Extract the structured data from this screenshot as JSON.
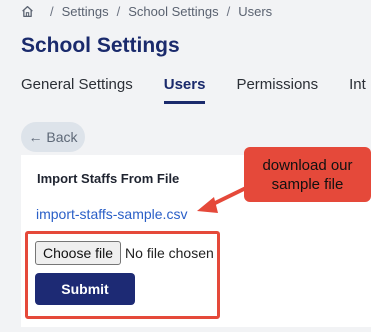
{
  "breadcrumb": {
    "home_icon": "home-icon",
    "items": [
      "Settings",
      "School Settings",
      "Users"
    ],
    "separator": "/"
  },
  "page": {
    "title": "School Settings"
  },
  "tabs": [
    {
      "label": "General Settings",
      "active": false
    },
    {
      "label": "Users",
      "active": true
    },
    {
      "label": "Permissions",
      "active": false
    },
    {
      "label": "Int",
      "active": false
    }
  ],
  "back_button": {
    "label": "← Back"
  },
  "import_card": {
    "heading": "Import Staffs From File",
    "sample_link": "import-staffs-sample.csv",
    "choose_file_label": "Choose file",
    "file_status": "No file chosen",
    "submit_label": "Submit"
  },
  "annotation": {
    "callout_text": "download our sample file",
    "color": "#e5493a"
  },
  "colors": {
    "brand": "#1a2a6c",
    "submit": "#1d2a74",
    "link": "#2a5fc7",
    "background": "#f2f3f5"
  }
}
